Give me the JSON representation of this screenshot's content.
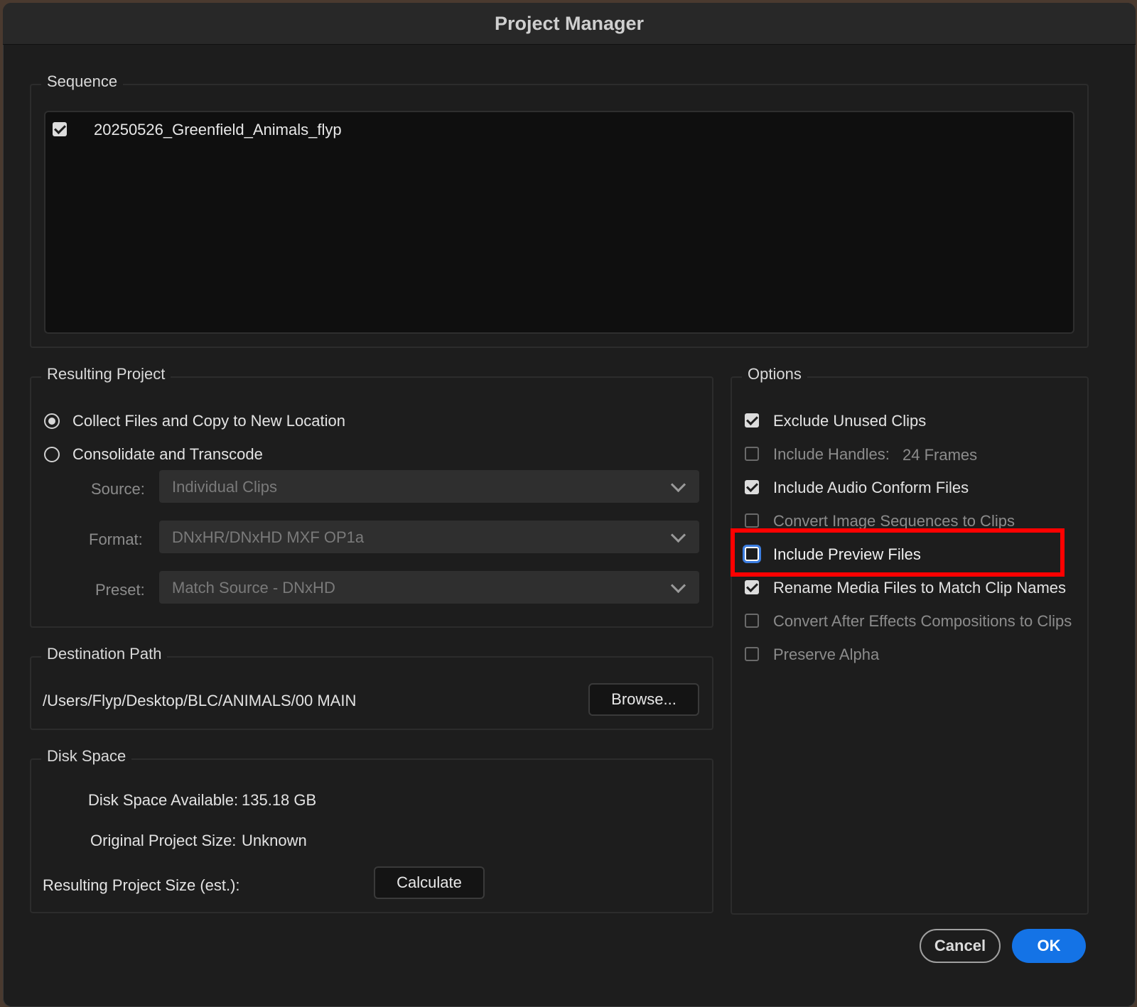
{
  "dialog": {
    "title": "Project Manager"
  },
  "sequence": {
    "label": "Sequence",
    "items": [
      {
        "name": "20250526_Greenfield_Animals_flyp",
        "checked": true
      }
    ]
  },
  "resulting_project": {
    "label": "Resulting Project",
    "options": [
      {
        "label": "Collect Files and Copy to New Location",
        "selected": true
      },
      {
        "label": "Consolidate and Transcode",
        "selected": false
      }
    ],
    "source_label": "Source:",
    "source_value": "Individual Clips",
    "format_label": "Format:",
    "format_value": "DNxHR/DNxHD MXF OP1a",
    "preset_label": "Preset:",
    "preset_value": "Match Source - DNxHD"
  },
  "options": {
    "label": "Options",
    "items": [
      {
        "label": "Exclude Unused Clips",
        "checked": true,
        "enabled": true
      },
      {
        "label": "Include Handles:",
        "checked": false,
        "enabled": false,
        "value": "24 Frames"
      },
      {
        "label": "Include Audio Conform Files",
        "checked": true,
        "enabled": true
      },
      {
        "label": "Convert Image Sequences to Clips",
        "checked": false,
        "enabled": false
      },
      {
        "label": "Include Preview Files",
        "checked": false,
        "enabled": true,
        "focused": true
      },
      {
        "label": "Rename Media Files to Match Clip Names",
        "checked": true,
        "enabled": true
      },
      {
        "label": "Convert After Effects Compositions to Clips",
        "checked": false,
        "enabled": false
      },
      {
        "label": "Preserve Alpha",
        "checked": false,
        "enabled": false
      }
    ]
  },
  "destination": {
    "label": "Destination Path",
    "path": "/Users/Flyp/Desktop/BLC/ANIMALS/00 MAIN",
    "browse_label": "Browse..."
  },
  "disk_space": {
    "label": "Disk Space",
    "available_label": "Disk Space Available:",
    "available_value": "135.18 GB",
    "original_label": "Original Project Size:",
    "original_value": "Unknown",
    "resulting_label": "Resulting Project Size (est.):",
    "calculate_label": "Calculate"
  },
  "footer": {
    "cancel_label": "Cancel",
    "ok_label": "OK"
  },
  "colors": {
    "accent": "#1473e6",
    "highlight": "#ff0000",
    "background": "#1d1d1d"
  }
}
